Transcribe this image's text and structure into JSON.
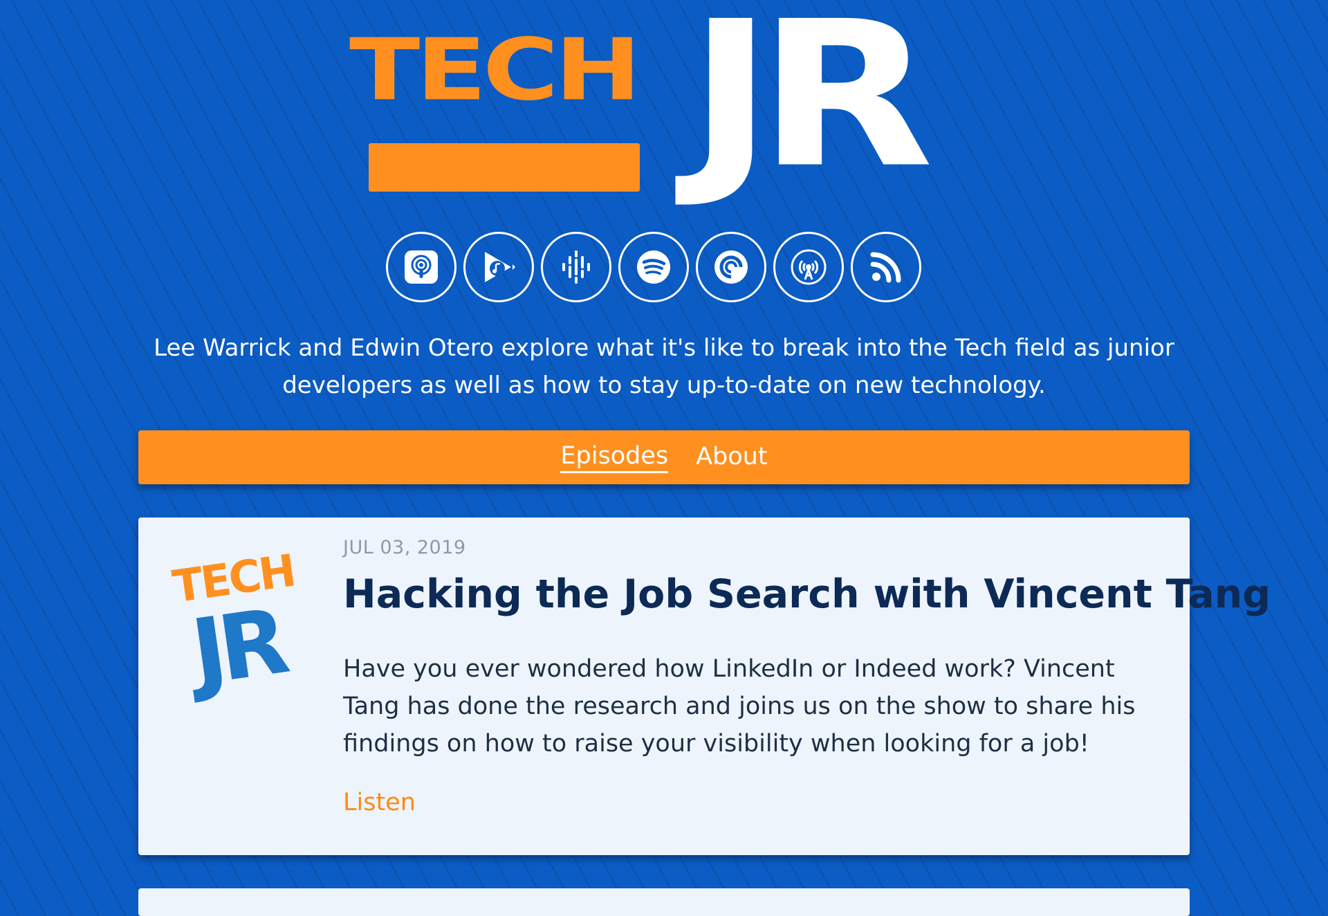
{
  "logo": {
    "word1": "TECH",
    "word2": "JR"
  },
  "podcast_links": [
    {
      "name": "apple-podcasts-icon",
      "color": "#ffffff"
    },
    {
      "name": "google-play-music-icon",
      "color": "#ffffff"
    },
    {
      "name": "google-podcasts-icon",
      "color": "#ffffff"
    },
    {
      "name": "spotify-icon",
      "color": "#ffffff"
    },
    {
      "name": "pocket-casts-icon",
      "color": "#ffffff"
    },
    {
      "name": "overcast-icon",
      "color": "#ffffff"
    },
    {
      "name": "rss-icon",
      "color": "#ffffff"
    }
  ],
  "tagline": "Lee Warrick and Edwin Otero explore what it's like to break into the Tech field as junior developers as well as how to stay up-to-date on new technology.",
  "nav": {
    "episodes": "Episodes",
    "about": "About"
  },
  "episodes": [
    {
      "thumb_word1": "TECH",
      "thumb_word2": "JR",
      "date": "JUL 03, 2019",
      "title": "Hacking the Job Search with Vincent Tang",
      "description": "Have you ever wondered how LinkedIn or Indeed work? Vincent Tang has done the research and joins us on the show to share his findings on how to raise your visibility when looking for a job!",
      "listen_label": "Listen"
    }
  ],
  "colors": {
    "background": "#0b5cc4",
    "accent_orange": "#ff9020",
    "card_bg": "#eef4fc",
    "title_navy": "#0c2a55"
  }
}
